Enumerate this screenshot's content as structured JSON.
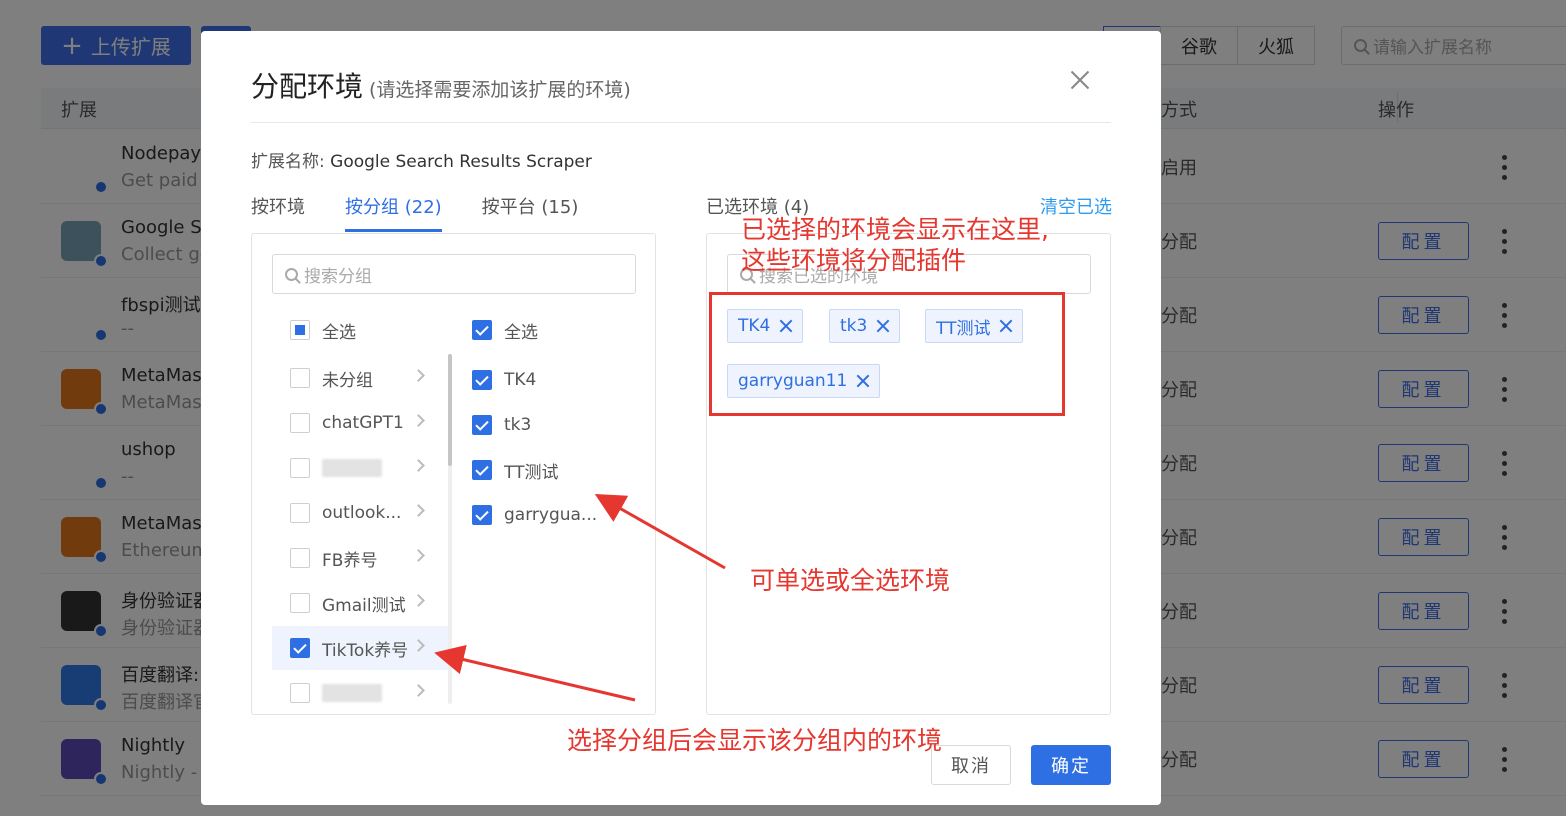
{
  "background": {
    "upload_label": "上传扩展",
    "browser_tabs": [
      "",
      "谷歌",
      "火狐"
    ],
    "search_placeholder": "请输入扩展名称",
    "columns": {
      "extension": "扩展",
      "mode": "方式",
      "actions": "操作"
    },
    "config_label": "配置",
    "rows": [
      {
        "name": "Nodepay E",
        "desc": "Get paid fo",
        "mode": "启用",
        "has_config": false,
        "icon_color": "#ffffff"
      },
      {
        "name": "Google Se",
        "desc": "Collect goo",
        "mode": "分配",
        "has_config": true,
        "icon_color": "#7aa2b8"
      },
      {
        "name": "fbspi测试",
        "desc": "--",
        "mode": "分配",
        "has_config": true,
        "icon_color": "#ffffff"
      },
      {
        "name": "MetaMask",
        "desc": "MetaMask",
        "mode": "分配",
        "has_config": true,
        "icon_color": "#e2761b"
      },
      {
        "name": "ushop",
        "desc": "--",
        "mode": "分配",
        "has_config": true,
        "icon_color": "#ffffff"
      },
      {
        "name": "MetaMask",
        "desc": "Ethereum",
        "mode": "分配",
        "has_config": true,
        "icon_color": "#e2761b"
      },
      {
        "name": "身份验证器",
        "desc": "身份验证器",
        "mode": "分配",
        "has_config": true,
        "icon_color": "#333333"
      },
      {
        "name": "百度翻译:",
        "desc": "百度翻译官",
        "mode": "分配",
        "has_config": true,
        "icon_color": "#2f7be8"
      },
      {
        "name": "Nightly",
        "desc": "Nightly - y",
        "mode": "分配",
        "has_config": true,
        "icon_color": "#5b4ab8"
      }
    ]
  },
  "modal": {
    "title": "分配环境",
    "subtitle": "(请选择需要添加该扩展的环境)",
    "ext_name_label": "扩展名称:",
    "ext_name_value": "Google Search Results Scraper",
    "tabs": [
      "按环境",
      "按分组 (22)",
      "按平台 (15)"
    ],
    "active_tab": "按分组 (22)",
    "group_search_placeholder": "搜索分组",
    "group_select_all": "全选",
    "groups": [
      {
        "label": "未分组",
        "checked": false,
        "blurred": false
      },
      {
        "label": "chatGPT1",
        "checked": false,
        "blurred": false
      },
      {
        "label": "",
        "checked": false,
        "blurred": true
      },
      {
        "label": "outlook...",
        "checked": false,
        "blurred": false
      },
      {
        "label": "FB养号",
        "checked": false,
        "blurred": false
      },
      {
        "label": "Gmail测试",
        "checked": false,
        "blurred": false
      },
      {
        "label": "TikTok养号",
        "checked": true,
        "blurred": false
      },
      {
        "label": "",
        "checked": false,
        "blurred": true
      }
    ],
    "env_select_all": "全选",
    "envs": [
      {
        "label": "TK4",
        "checked": true
      },
      {
        "label": "tk3",
        "checked": true
      },
      {
        "label": "TT测试",
        "checked": true
      },
      {
        "label": "garrygua...",
        "checked": true
      }
    ],
    "selected_title": "已选环境 (4)",
    "clear_label": "清空已选",
    "selected_search_placeholder": "搜索已选的环境",
    "selected_tags": [
      "TK4",
      "tk3",
      "TT测试",
      "garryguan11"
    ],
    "cancel_label": "取消",
    "ok_label": "确定"
  },
  "annotations": {
    "selected_note_line1": "已选择的环境会显示在这里,",
    "selected_note_line2": "这些环境将分配插件",
    "single_or_all_note": "可单选或全选环境",
    "group_note": "选择分组后会显示该分组内的环境",
    "color": "#e5372f"
  }
}
